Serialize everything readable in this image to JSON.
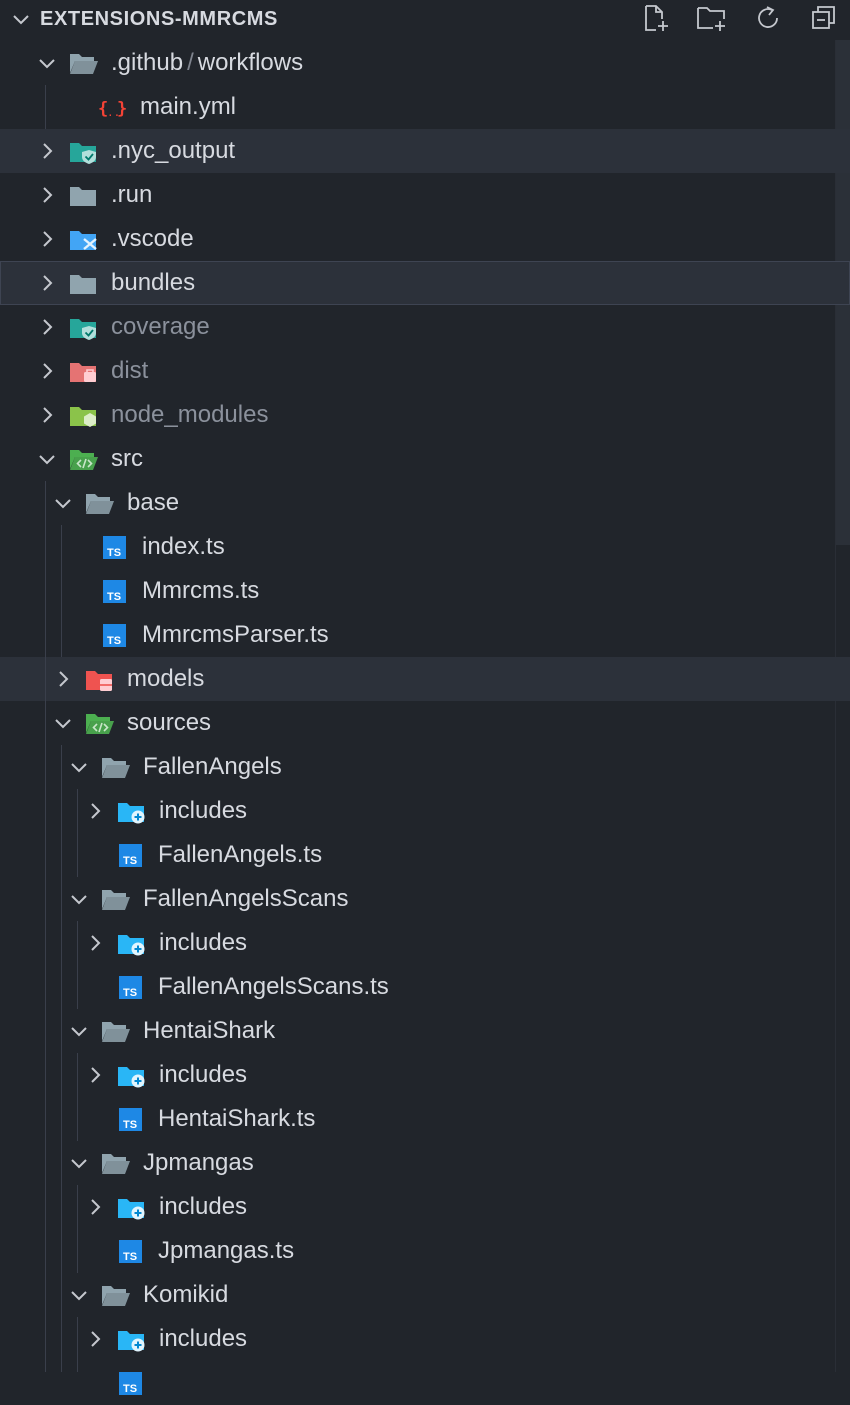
{
  "explorer": {
    "title": "EXTENSIONS-MMRCMS",
    "actions": [
      {
        "name": "new-file-icon"
      },
      {
        "name": "new-folder-icon"
      },
      {
        "name": "refresh-icon"
      },
      {
        "name": "collapse-all-icon"
      }
    ]
  },
  "tree": [
    {
      "label": ".github",
      "label2": "workflows",
      "depth": 0,
      "expanded": true,
      "icon": "folder-open-gray-icon",
      "kind": "folder"
    },
    {
      "label": "main.yml",
      "depth": 1,
      "icon": "yaml-icon",
      "kind": "file"
    },
    {
      "label": ".nyc_output",
      "depth": 0,
      "expanded": false,
      "icon": "folder-teal-shield-icon",
      "kind": "folder",
      "selected": true
    },
    {
      "label": ".run",
      "depth": 0,
      "expanded": false,
      "icon": "folder-gray-icon",
      "kind": "folder"
    },
    {
      "label": ".vscode",
      "depth": 0,
      "expanded": false,
      "icon": "folder-vscode-icon",
      "kind": "folder"
    },
    {
      "label": "bundles",
      "depth": 0,
      "expanded": false,
      "icon": "folder-gray-icon",
      "kind": "folder",
      "focus": true
    },
    {
      "label": "coverage",
      "depth": 0,
      "expanded": false,
      "icon": "folder-teal-shield-icon",
      "kind": "folder",
      "dim": true
    },
    {
      "label": "dist",
      "depth": 0,
      "expanded": false,
      "icon": "folder-red-dist-icon",
      "kind": "folder",
      "dim": true
    },
    {
      "label": "node_modules",
      "depth": 0,
      "expanded": false,
      "icon": "folder-green-node-icon",
      "kind": "folder",
      "dim": true
    },
    {
      "label": "src",
      "depth": 0,
      "expanded": true,
      "icon": "folder-green-src-icon",
      "kind": "folder"
    },
    {
      "label": "base",
      "depth": 1,
      "expanded": true,
      "icon": "folder-open-gray-icon",
      "kind": "folder"
    },
    {
      "label": "index.ts",
      "depth": 2,
      "icon": "typescript-icon",
      "kind": "file"
    },
    {
      "label": "Mmrcms.ts",
      "depth": 2,
      "icon": "typescript-icon",
      "kind": "file"
    },
    {
      "label": "MmrcmsParser.ts",
      "depth": 2,
      "icon": "typescript-icon",
      "kind": "file"
    },
    {
      "label": "models",
      "depth": 1,
      "expanded": false,
      "icon": "folder-red-models-icon",
      "kind": "folder",
      "selected": true
    },
    {
      "label": "sources",
      "depth": 1,
      "expanded": true,
      "icon": "folder-green-src-icon",
      "kind": "folder"
    },
    {
      "label": "FallenAngels",
      "depth": 2,
      "expanded": true,
      "icon": "folder-open-gray-icon",
      "kind": "folder"
    },
    {
      "label": "includes",
      "depth": 3,
      "expanded": false,
      "icon": "folder-blue-include-icon",
      "kind": "folder"
    },
    {
      "label": "FallenAngels.ts",
      "depth": 3,
      "icon": "typescript-icon",
      "kind": "file"
    },
    {
      "label": "FallenAngelsScans",
      "depth": 2,
      "expanded": true,
      "icon": "folder-open-gray-icon",
      "kind": "folder"
    },
    {
      "label": "includes",
      "depth": 3,
      "expanded": false,
      "icon": "folder-blue-include-icon",
      "kind": "folder"
    },
    {
      "label": "FallenAngelsScans.ts",
      "depth": 3,
      "icon": "typescript-icon",
      "kind": "file"
    },
    {
      "label": "HentaiShark",
      "depth": 2,
      "expanded": true,
      "icon": "folder-open-gray-icon",
      "kind": "folder"
    },
    {
      "label": "includes",
      "depth": 3,
      "expanded": false,
      "icon": "folder-blue-include-icon",
      "kind": "folder"
    },
    {
      "label": "HentaiShark.ts",
      "depth": 3,
      "icon": "typescript-icon",
      "kind": "file"
    },
    {
      "label": "Jpmangas",
      "depth": 2,
      "expanded": true,
      "icon": "folder-open-gray-icon",
      "kind": "folder"
    },
    {
      "label": "includes",
      "depth": 3,
      "expanded": false,
      "icon": "folder-blue-include-icon",
      "kind": "folder"
    },
    {
      "label": "Jpmangas.ts",
      "depth": 3,
      "icon": "typescript-icon",
      "kind": "file"
    },
    {
      "label": "Komikid",
      "depth": 2,
      "expanded": true,
      "icon": "folder-open-gray-icon",
      "kind": "folder"
    },
    {
      "label": "includes",
      "depth": 3,
      "expanded": false,
      "icon": "folder-blue-include-icon",
      "kind": "folder"
    },
    {
      "label": "",
      "depth": 3,
      "icon": "typescript-icon",
      "kind": "file"
    }
  ]
}
